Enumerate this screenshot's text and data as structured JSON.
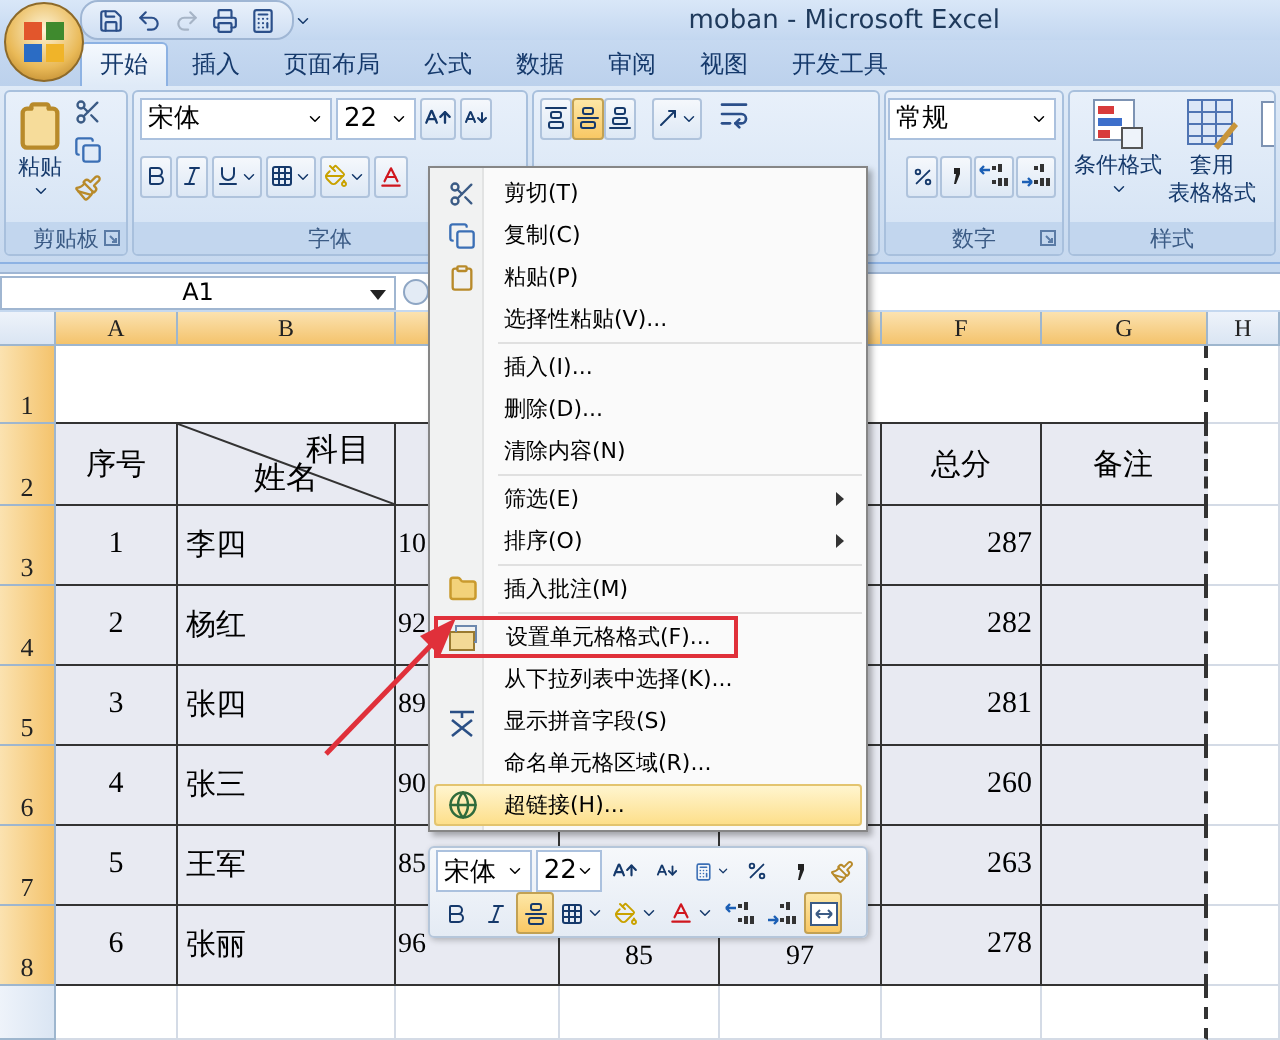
{
  "window": {
    "title": "moban - Microsoft Excel"
  },
  "ribbon_tabs": [
    {
      "label": "开始",
      "selected": true
    },
    {
      "label": "插入",
      "selected": false
    },
    {
      "label": "页面布局",
      "selected": false
    },
    {
      "label": "公式",
      "selected": false
    },
    {
      "label": "数据",
      "selected": false
    },
    {
      "label": "审阅",
      "selected": false
    },
    {
      "label": "视图",
      "selected": false
    },
    {
      "label": "开发工具",
      "selected": false
    }
  ],
  "ribbon": {
    "clipboard": {
      "paste_label": "粘贴",
      "group_label": "剪贴板"
    },
    "font": {
      "name": "宋体",
      "size": "22",
      "group_label": "字体"
    },
    "alignment": {
      "middle_align_on": true
    },
    "number": {
      "format": "常规",
      "group_label": "数字"
    },
    "styles": {
      "conditional_label": "条件格式",
      "table_label_1": "套用",
      "table_label_2": "表格格式",
      "group_label": "样式"
    }
  },
  "name_box": "A1",
  "sheet": {
    "columns": [
      "A",
      "B",
      "F",
      "G",
      "H"
    ],
    "rows": [
      "1",
      "2",
      "3",
      "4",
      "5",
      "6",
      "7",
      "8"
    ],
    "header": {
      "seq": "序号",
      "subject": "科目",
      "name": "姓名",
      "total": "总分",
      "note": "备注"
    },
    "data": [
      {
        "seq": "1",
        "name": "李四",
        "c": "10",
        "total": "287"
      },
      {
        "seq": "2",
        "name": "杨红",
        "c": "92",
        "total": "282"
      },
      {
        "seq": "3",
        "name": "张四",
        "c": "89",
        "total": "281"
      },
      {
        "seq": "4",
        "name": "张三",
        "c": "90",
        "total": "260"
      },
      {
        "seq": "5",
        "name": "王军",
        "c": "85",
        "total": "263"
      },
      {
        "seq": "6",
        "name": "张丽",
        "c": "96",
        "d": "85",
        "e": "97",
        "total": "278"
      }
    ]
  },
  "context_menu": {
    "sections": [
      [
        {
          "label": "剪切(T)",
          "submenu": false,
          "highlighted": false,
          "annotated": false
        },
        {
          "label": "复制(C)",
          "submenu": false,
          "highlighted": false,
          "annotated": false
        },
        {
          "label": "粘贴(P)",
          "submenu": false,
          "highlighted": false,
          "annotated": false
        },
        {
          "label": "选择性粘贴(V)...",
          "submenu": false,
          "highlighted": false,
          "annotated": false
        }
      ],
      [
        {
          "label": "插入(I)...",
          "submenu": false,
          "highlighted": false,
          "annotated": false
        },
        {
          "label": "删除(D)...",
          "submenu": false,
          "highlighted": false,
          "annotated": false
        },
        {
          "label": "清除内容(N)",
          "submenu": false,
          "highlighted": false,
          "annotated": false
        }
      ],
      [
        {
          "label": "筛选(E)",
          "submenu": true,
          "highlighted": false,
          "annotated": false
        },
        {
          "label": "排序(O)",
          "submenu": true,
          "highlighted": false,
          "annotated": false
        }
      ],
      [
        {
          "label": "插入批注(M)",
          "submenu": false,
          "highlighted": false,
          "annotated": false
        }
      ],
      [
        {
          "label": "设置单元格格式(F)...",
          "submenu": false,
          "highlighted": false,
          "annotated": true
        },
        {
          "label": "从下拉列表中选择(K)...",
          "submenu": false,
          "highlighted": false,
          "annotated": false
        },
        {
          "label": "显示拼音字段(S)",
          "submenu": false,
          "highlighted": false,
          "annotated": false
        },
        {
          "label": "命名单元格区域(R)...",
          "submenu": false,
          "highlighted": false,
          "annotated": false
        },
        {
          "label": "超链接(H)...",
          "submenu": false,
          "highlighted": true,
          "annotated": false
        }
      ]
    ]
  },
  "mini_toolbar": {
    "font": "宋体",
    "size": "22",
    "center_on": true,
    "merge_on": true
  }
}
